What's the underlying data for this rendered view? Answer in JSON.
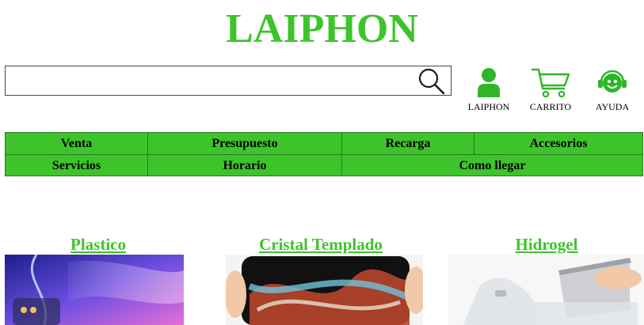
{
  "header": {
    "brand": "LAIPHON"
  },
  "search": {
    "value": "",
    "placeholder": ""
  },
  "actions": [
    {
      "label": "LAIPHON",
      "icon": "user-icon"
    },
    {
      "label": "CARRITO",
      "icon": "cart-icon"
    },
    {
      "label": "AYUDA",
      "icon": "support-icon"
    }
  ],
  "nav": {
    "row1": [
      "Venta",
      "Presupuesto",
      "Recarga",
      "Accesorios"
    ],
    "row2": [
      "Servicios",
      "Horario",
      "Como llegar"
    ]
  },
  "categories": [
    {
      "title": "Plastico"
    },
    {
      "title": "Cristal Templado"
    },
    {
      "title": "Hidrogel"
    }
  ],
  "colors": {
    "accent": "#3dc42b",
    "border": "#2a7a1f"
  }
}
